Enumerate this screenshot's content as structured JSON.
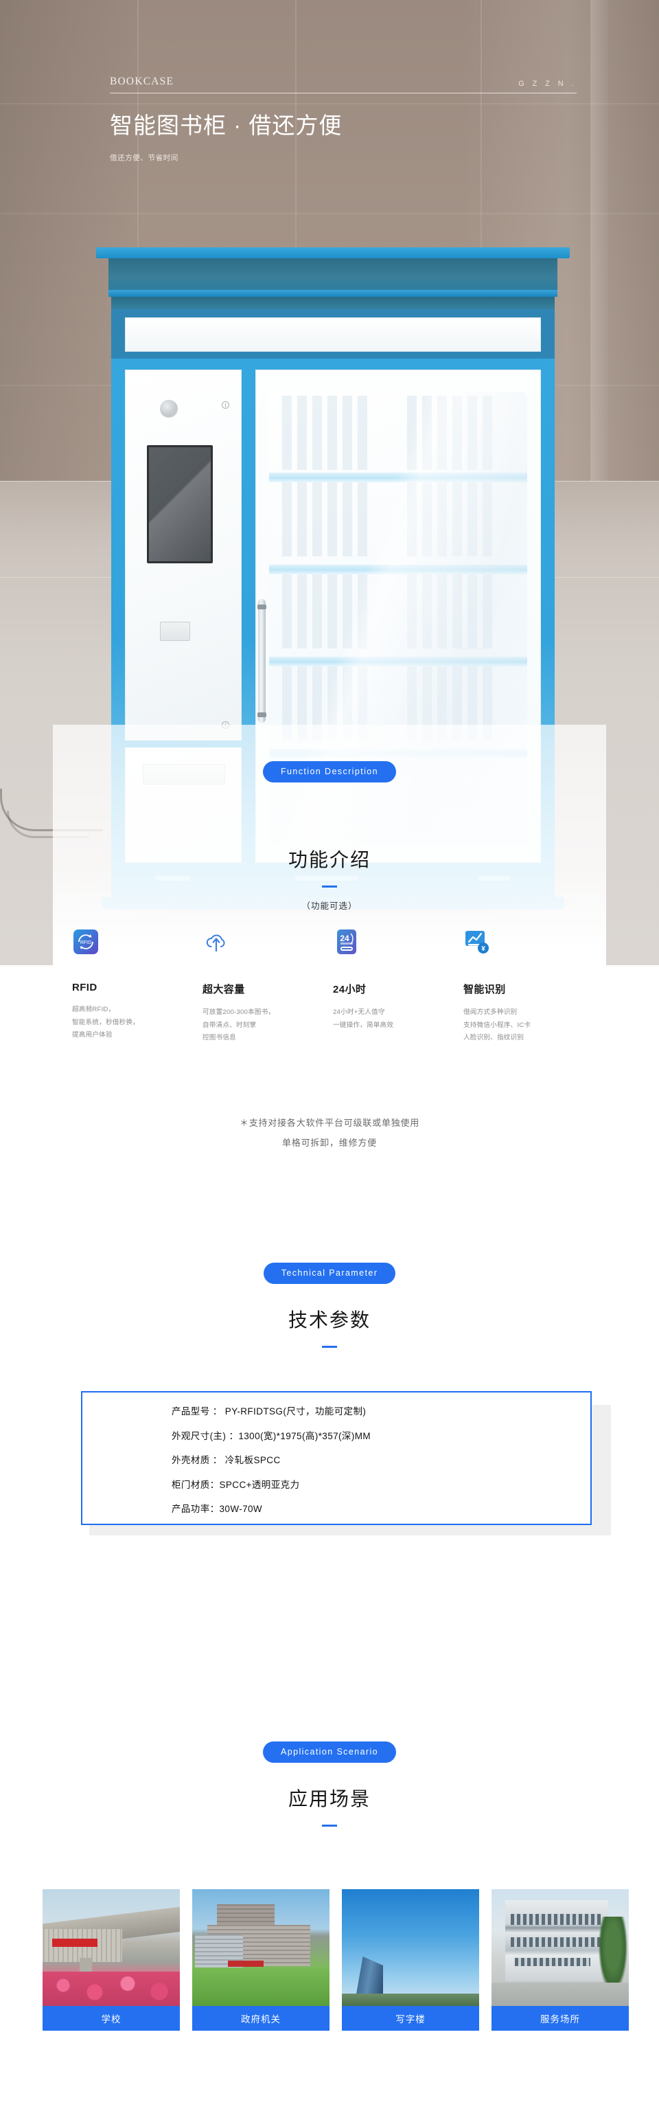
{
  "hero": {
    "eyebrow": "BOOKCASE",
    "brand": "G Z Z N .",
    "title": "智能图书柜 · 借还方便",
    "subtitle": "借还方便、节省时间"
  },
  "function_section": {
    "pill_label": "Function  Description",
    "title": "功能介绍",
    "note": "（功能可选）",
    "features": [
      {
        "icon": "rfid-icon",
        "title": "RFID",
        "desc": [
          "超高频RFID，",
          "智能系统，秒借秒换，",
          "提高用户体验"
        ]
      },
      {
        "icon": "cloud-upload-icon",
        "title": "超大容量",
        "desc": [
          "可放置200-300本图书，",
          "自带清点、时刻掌",
          "控图书信息"
        ]
      },
      {
        "icon": "24-hours-icon",
        "title": "24小时",
        "desc": [
          "24小时+无人值守",
          "一键操作，简单高效"
        ]
      },
      {
        "icon": "smart-recognition-icon",
        "title": "智能识别",
        "desc": [
          "借阅方式多种识别",
          "支持微信小程序、IC卡",
          "人脸识别、指纹识别"
        ]
      }
    ],
    "star_note_line1": "＊支持对接各大软件平台可级联或单独使用",
    "star_note_line2": "单格可拆卸，维修方便"
  },
  "technical_section": {
    "pill_label": "Technical  Parameter",
    "title": "技术参数",
    "specs": [
      "产品型号 ： PY-RFIDTSG(尺寸，功能可定制)",
      "外观尺寸(主) ：1300(宽)*1975(高)*357(深)MM",
      "外壳材质 ： 冷轧板SPCC",
      "柜门材质：SPCC+透明亚克力",
      "产品功率：30W-70W"
    ]
  },
  "application_section": {
    "pill_label": "Application  Scenario",
    "title": "应用场景",
    "cards": [
      {
        "label": "学校",
        "photo": "university-campus-photo"
      },
      {
        "label": "政府机关",
        "photo": "government-building-photo"
      },
      {
        "label": "写字楼",
        "photo": "office-tower-photo"
      },
      {
        "label": "服务场所",
        "photo": "service-center-photo"
      }
    ]
  },
  "colors": {
    "accent_blue": "#2470f0",
    "kiosk_blue": "#35a6de",
    "hero_bg": "#a3928 7"
  }
}
